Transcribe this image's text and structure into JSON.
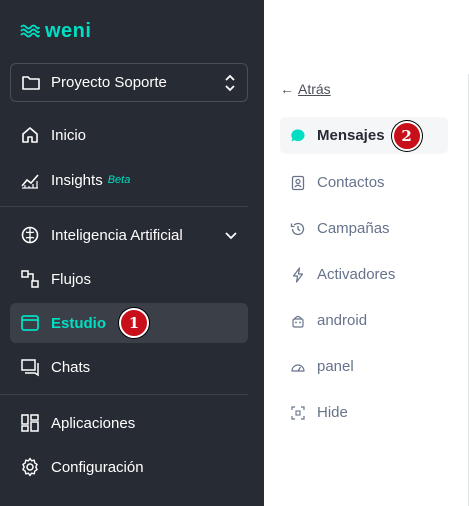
{
  "brand": {
    "name": "weni"
  },
  "project": {
    "name": "Proyecto Soporte"
  },
  "nav": {
    "inicio": "Inicio",
    "insights": "Insights",
    "insights_badge": "Beta",
    "ia": "Inteligencia Artificial",
    "flujos": "Flujos",
    "estudio": "Estudio",
    "chats": "Chats",
    "aplicaciones": "Aplicaciones",
    "configuracion": "Configuración"
  },
  "submenu": {
    "back_label": "Atrás",
    "mensajes": "Mensajes",
    "contactos": "Contactos",
    "campanas": "Campañas",
    "activadores": "Activadores",
    "android": "android",
    "panel": "panel",
    "hide": "Hide"
  },
  "annotations": {
    "step1": "1",
    "step2": "2"
  },
  "colors": {
    "accent": "#00dec3",
    "sidebar_bg": "#272b33",
    "badge": "#c8101a"
  }
}
